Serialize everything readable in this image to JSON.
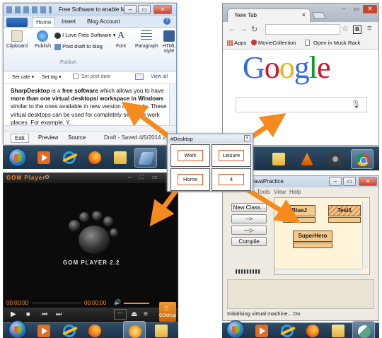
{
  "word": {
    "title": "Free Software to enable Multi...",
    "tabs": [
      "Home",
      "Insert",
      "Blog Account"
    ],
    "ribbon": {
      "clipboard": "Clipboard",
      "publish": "Publish",
      "blog_name": "I Love Free Software",
      "post_draft": "Post draft to blog",
      "font": "Font",
      "paragraph": "Paragraph",
      "html_style": "HTML style",
      "group_label": "Publish"
    },
    "postbar": {
      "set_category": "Set cate",
      "set_tags": "Set tag",
      "set_post_date": "Set post date",
      "view_all": "View all"
    },
    "doc": {
      "b1": "SharpDesktop",
      "t1": " is a ",
      "b2": "free software",
      "t2": " which allows you to have ",
      "b3": "more than one virtual desktops/ workspace in Windows",
      "t3": " similar to the ones available in new version of Ubuntu. These virtual desktops can be used for completely separate work places. For example, Y..."
    },
    "bottom_tabs": [
      "Edit",
      "Preview",
      "Source"
    ],
    "status": "Draft - Saved 4/5/2014 2:"
  },
  "chrome": {
    "tab_title": "New Tab",
    "bookmarks": [
      "Apps",
      "MovieCollection",
      "Open in Muck Rack"
    ],
    "logo_letters": [
      {
        "ch": "G",
        "color": "#3369e8"
      },
      {
        "ch": "o",
        "color": "#d50f25"
      },
      {
        "ch": "o",
        "color": "#eeb211"
      },
      {
        "ch": "g",
        "color": "#3369e8"
      },
      {
        "ch": "l",
        "color": "#009925"
      },
      {
        "ch": "e",
        "color": "#d50f25"
      }
    ],
    "mic": "🎙"
  },
  "gom": {
    "app_name": "GOM Player",
    "logo_text": "GOM PLAYER 2.2",
    "time_current": "00:00:00",
    "time_total": "00:00:00",
    "hub_label": "GOMhub"
  },
  "bluej": {
    "title": "JavaPractice",
    "menu": [
      "Tools",
      "View",
      "Help"
    ],
    "new_class": "New Class...",
    "compile": "Compile",
    "classes": [
      "BlueJ",
      "Test1",
      "SuperHero"
    ],
    "status": "Initialising virtual machine... Do"
  },
  "desktop_widget": {
    "title": "#Desktop",
    "cells": [
      "Work",
      "Leisure",
      "Home",
      "4"
    ]
  },
  "colors": {
    "arrow": "#f58a1f",
    "cell_border": "#e05a28"
  }
}
